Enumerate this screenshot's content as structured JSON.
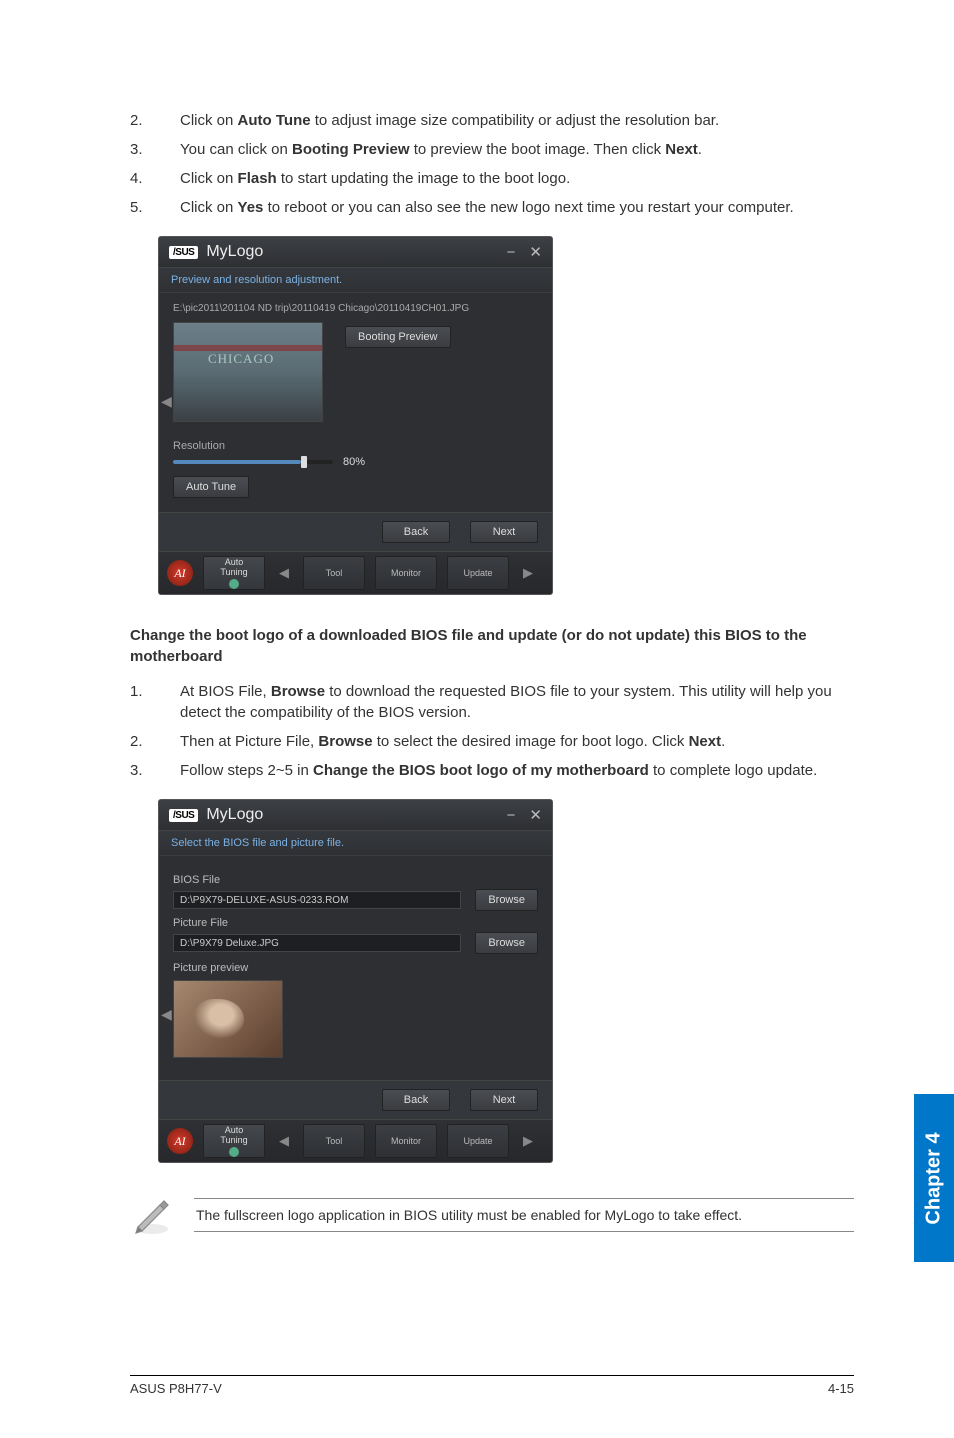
{
  "steps_a": [
    {
      "n": "2.",
      "t": [
        "Click on ",
        {
          "b": "Auto Tune"
        },
        " to adjust image size compatibility or adjust the resolution bar."
      ]
    },
    {
      "n": "3.",
      "t": [
        "You can click on ",
        {
          "b": "Booting Preview"
        },
        " to preview the boot image. Then click ",
        {
          "b": "Next"
        },
        "."
      ]
    },
    {
      "n": "4.",
      "t": [
        "Click on ",
        {
          "b": "Flash"
        },
        " to start updating the image to the boot logo."
      ]
    },
    {
      "n": "5.",
      "t": [
        "Click on ",
        {
          "b": "Yes"
        },
        " to reboot or you can also see the new logo next time you restart your computer."
      ]
    }
  ],
  "section_head": "Change the boot logo of a downloaded BIOS file and update (or do not update) this BIOS to the motherboard",
  "steps_b": [
    {
      "n": "1.",
      "t": [
        "At BIOS File, ",
        {
          "b": "Browse"
        },
        " to download the requested BIOS file to your system. This utility will help you detect the compatibility of the BIOS version."
      ]
    },
    {
      "n": "2.",
      "t": [
        "Then at Picture File, ",
        {
          "b": "Browse"
        },
        " to select the desired image for boot logo. Click ",
        {
          "b": "Next"
        },
        "."
      ]
    },
    {
      "n": "3.",
      "t": [
        "Follow steps 2~5 in ",
        {
          "b": "Change the BIOS boot logo of my motherboard"
        },
        " to complete logo update."
      ]
    }
  ],
  "win1": {
    "brand": "/SUS",
    "title": "MyLogo",
    "sub": "Preview and resolution adjustment.",
    "path": "E:\\pic2011\\201104 ND trip\\20110419 Chicago\\20110419CH01.JPG",
    "booting_preview_btn": "Booting Preview",
    "resolution_label": "Resolution",
    "slider_value": "80%",
    "auto_tune_btn": "Auto Tune",
    "back_btn": "Back",
    "next_btn": "Next",
    "tabs": {
      "auto": "Auto\nTuning",
      "tool": "Tool",
      "monitor": "Monitor",
      "update": "Update"
    }
  },
  "win2": {
    "brand": "/SUS",
    "title": "MyLogo",
    "sub": "Select the BIOS file and picture file.",
    "bios_label": "BIOS File",
    "bios_value": "D:\\P9X79-DELUXE-ASUS-0233.ROM",
    "pic_label": "Picture File",
    "pic_value": "D:\\P9X79 Deluxe.JPG",
    "browse_btn": "Browse",
    "preview_label": "Picture preview",
    "back_btn": "Back",
    "next_btn": "Next",
    "tabs": {
      "auto": "Auto\nTuning",
      "tool": "Tool",
      "monitor": "Monitor",
      "update": "Update"
    }
  },
  "note": "The fullscreen logo application in BIOS utility must be enabled for MyLogo to take effect.",
  "chapter_tab": "Chapter 4",
  "footer_left": "ASUS P8H77-V",
  "footer_right": "4-15"
}
